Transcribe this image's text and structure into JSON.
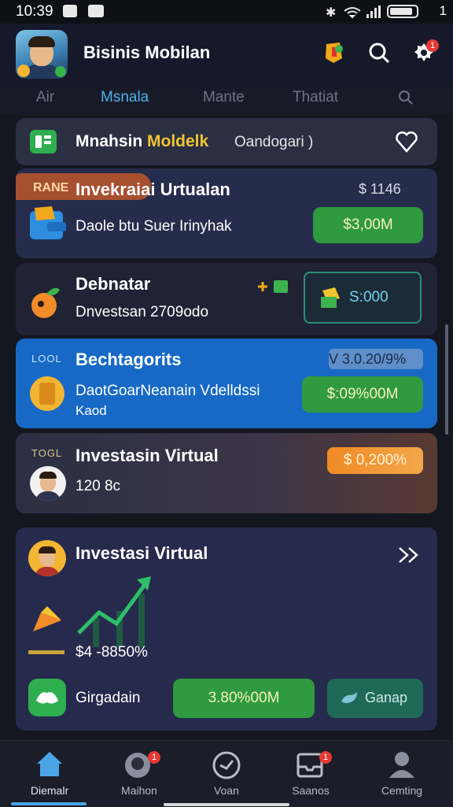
{
  "status": {
    "time": "10:39",
    "battery_extra": "1"
  },
  "header": {
    "title": "Bisinis Mobilan",
    "notif_count": "1"
  },
  "tabs": [
    {
      "label": "Air"
    },
    {
      "label": "Msnala"
    },
    {
      "label": "Mante"
    },
    {
      "label": "Thatiat"
    }
  ],
  "search_card": {
    "title_white": "Mnahsin ",
    "title_yellow": "Moldelk",
    "subtitle": "Oandogari )"
  },
  "card1": {
    "ribbon": "RANE",
    "title": "Invekraiai Urtualan",
    "amount": "$ 1146",
    "desc": "Daole btu Suer Irinyhak",
    "button": "$3,00M"
  },
  "card2": {
    "title": "Debnatar",
    "desc": "Dnvestsan 2709odo",
    "button": "S:000"
  },
  "card3": {
    "label": "LOOL",
    "title": "Bechtagorits",
    "pct": "V 3.0.20/9%",
    "desc_line1": "DaotGoarNeanain Vdelldssi",
    "desc_line2": "Kaod",
    "button": "$:09%00M"
  },
  "card4": {
    "label": "TOGL",
    "title": "Investasin Virtual",
    "desc": "120 8c",
    "button": "$ 0,200%"
  },
  "card5": {
    "title": "Investasi Virtual",
    "chart_value": "$4 -8850%",
    "action_label": "Girgadain",
    "button_primary": "3.80%00M",
    "button_secondary": "Ganap"
  },
  "nav": [
    {
      "label": "Diemalr",
      "icon": "home-icon"
    },
    {
      "label": "Maihon",
      "icon": "chat-icon",
      "badge": "1"
    },
    {
      "label": "Voan",
      "icon": "compass-icon"
    },
    {
      "label": "Saanos",
      "icon": "inbox-icon",
      "badge": "1"
    },
    {
      "label": "Cemting",
      "icon": "profile-icon"
    }
  ],
  "colors": {
    "accent": "#4fb1ec",
    "green": "#2f9a3f",
    "blue_card": "#1769c5",
    "orange": "#f28c2a"
  }
}
